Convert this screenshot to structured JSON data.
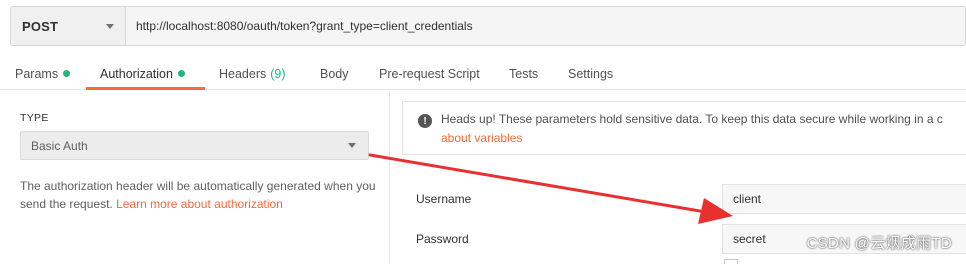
{
  "request": {
    "method": "POST",
    "url": "http://localhost:8080/oauth/token?grant_type=client_credentials"
  },
  "tabs": [
    {
      "label": "Params",
      "dot": true
    },
    {
      "label": "Authorization",
      "dot": true,
      "active": true
    },
    {
      "label": "Headers",
      "count": "(9)"
    },
    {
      "label": "Body"
    },
    {
      "label": "Pre-request Script"
    },
    {
      "label": "Tests"
    },
    {
      "label": "Settings"
    }
  ],
  "auth": {
    "type_label": "TYPE",
    "type_value": "Basic Auth",
    "description": "The authorization header will be automatically generated when you send the request.",
    "learn_more": "Learn more about authorization"
  },
  "notice": {
    "text": "Heads up! These parameters hold sensitive data. To keep this data secure while working in a c",
    "link": "about variables"
  },
  "fields": {
    "username_label": "Username",
    "username_value": "client",
    "password_label": "Password",
    "password_value": "secret"
  },
  "annotation": {
    "arrow_color": "#e8302e"
  },
  "watermark": "CSDN @云烟成雨TD",
  "colors": {
    "accent": "#f26b3a",
    "green": "#26b47f"
  }
}
